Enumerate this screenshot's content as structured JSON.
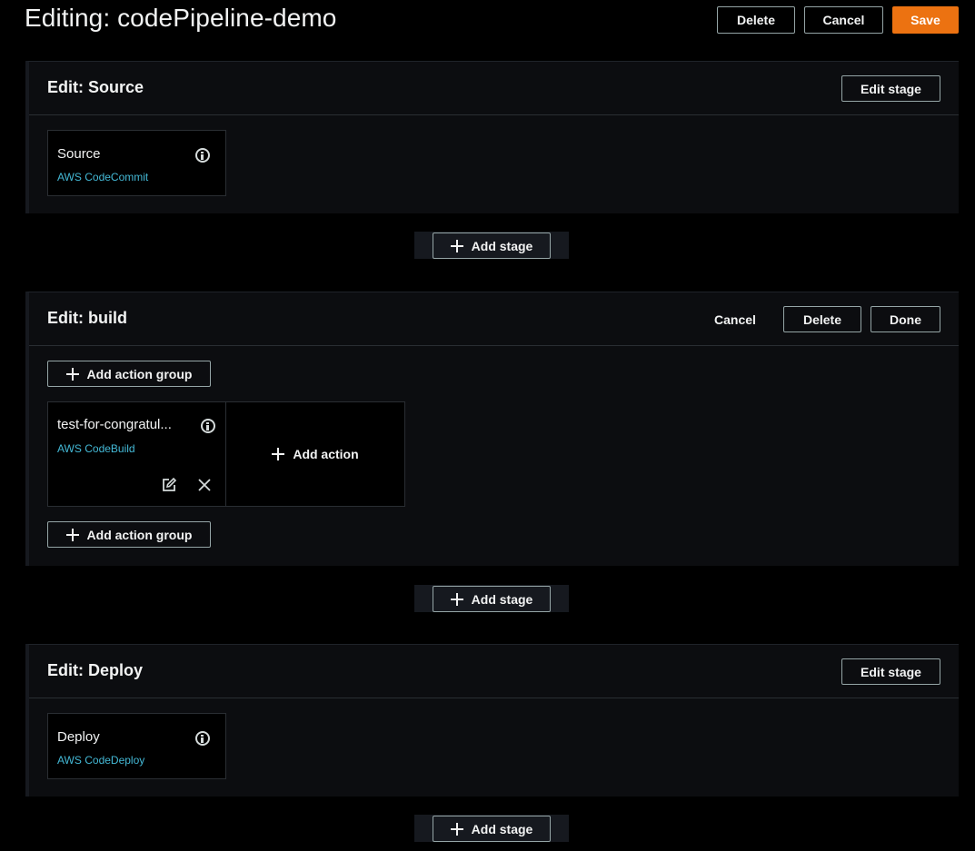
{
  "header": {
    "title": "Editing: codePipeline-demo",
    "delete_label": "Delete",
    "cancel_label": "Cancel",
    "save_label": "Save"
  },
  "stages": [
    {
      "title": "Edit: Source",
      "edit_label": "Edit stage",
      "action": {
        "name": "Source",
        "provider": "AWS CodeCommit"
      },
      "add_stage_label": "Add stage"
    },
    {
      "title": "Edit: build",
      "cancel_label": "Cancel",
      "delete_label": "Delete",
      "done_label": "Done",
      "add_action_group_label": "Add action group",
      "action": {
        "name": "test-for-congratul...",
        "provider": "AWS CodeBuild"
      },
      "add_action_label": "Add action",
      "add_action_group_bottom_label": "Add action group",
      "add_stage_label": "Add stage"
    },
    {
      "title": "Edit: Deploy",
      "edit_label": "Edit stage",
      "action": {
        "name": "Deploy",
        "provider": "AWS CodeDeploy"
      },
      "add_stage_label": "Add stage"
    }
  ],
  "colors": {
    "primary": "#ec7211",
    "link": "#44b9d6",
    "background": "#000000"
  },
  "icons": [
    "info-icon",
    "plus-icon",
    "edit-icon",
    "close-icon"
  ]
}
